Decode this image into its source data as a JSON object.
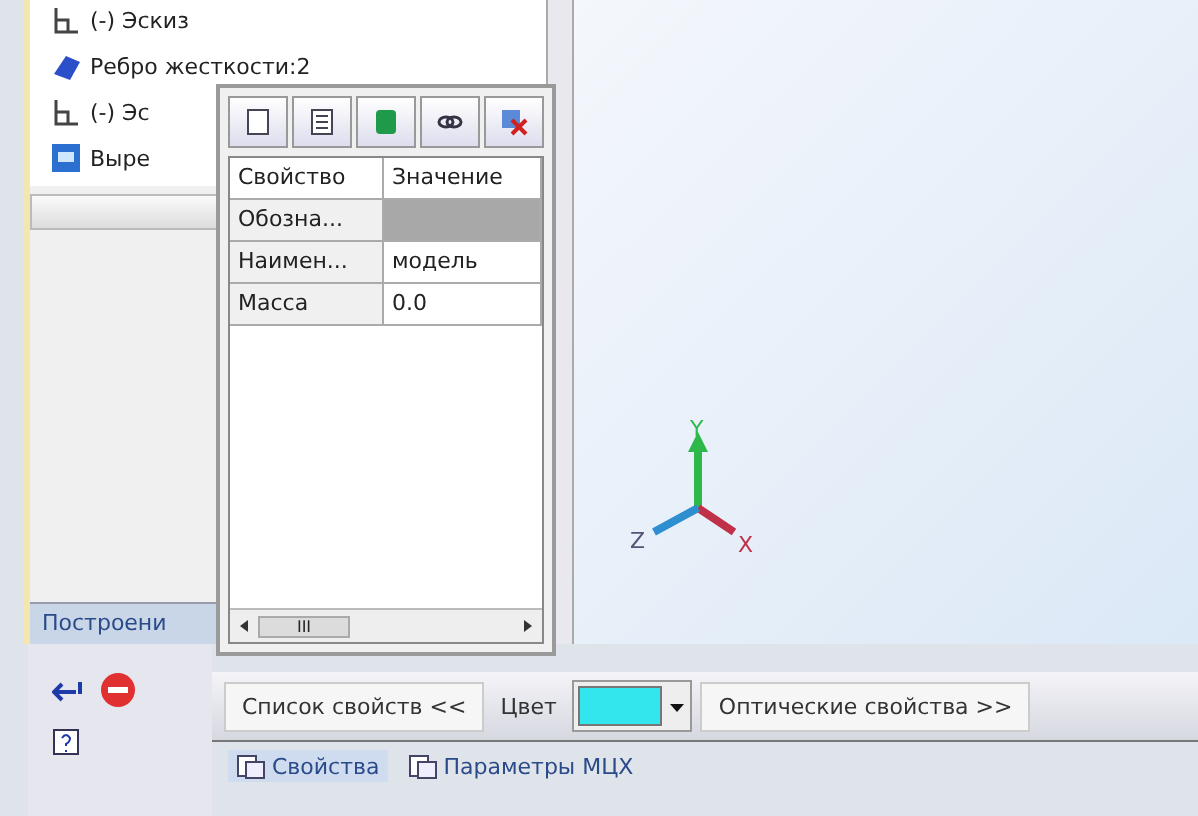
{
  "tree": {
    "items": [
      {
        "label": "(-) Эскиз",
        "kind": "sketch"
      },
      {
        "label": "Ребро жесткости:2",
        "kind": "rib"
      },
      {
        "label": "(-) Эс",
        "kind": "sketch"
      },
      {
        "label": "Выре",
        "kind": "cut"
      }
    ],
    "tab": "Построени"
  },
  "properties_panel": {
    "columns": [
      "Свойство",
      "Значение"
    ],
    "rows": [
      {
        "property": "Обозна...",
        "value": "",
        "selected": true
      },
      {
        "property": "Наимен...",
        "value": "модель",
        "selected": false
      },
      {
        "property": "Масса",
        "value": "0.0",
        "selected": false
      }
    ],
    "scroll_thumb": "III"
  },
  "viewport": {
    "axes": [
      "Y",
      "Z",
      "X"
    ]
  },
  "property_bar": {
    "list_button": "Список свойств  <<",
    "color_label": "Цвет",
    "color": "#33e6ee",
    "optics_button": "Оптические свойства  >>"
  },
  "bottom_tabs": [
    {
      "label": "Свойства",
      "selected": true
    },
    {
      "label": "Параметры МЦХ",
      "selected": false
    }
  ]
}
